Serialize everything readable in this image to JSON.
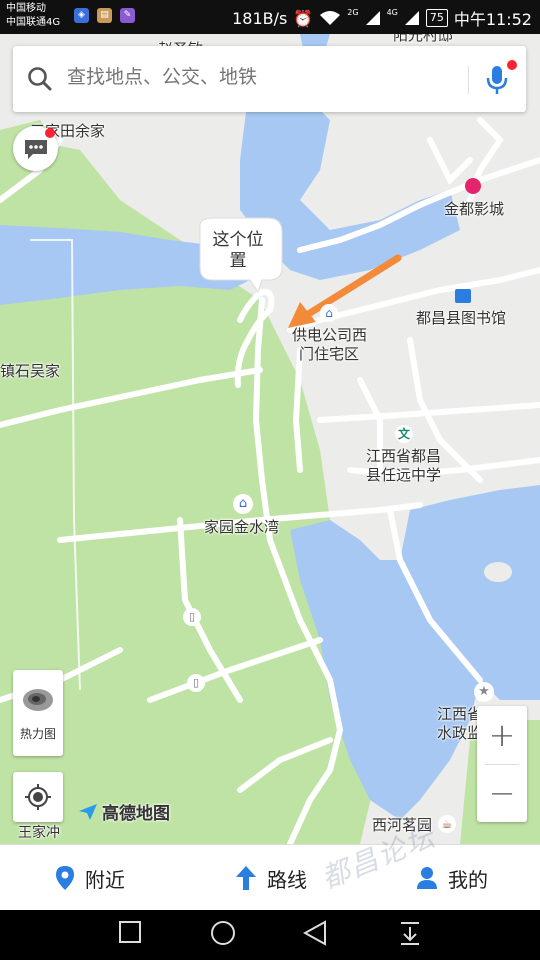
{
  "status_bar": {
    "carrier_1": "中国移动",
    "carrier_2": "中国联通4G",
    "speed": "181B/s",
    "net_label_1": "2G",
    "net_label_2": "4G",
    "battery": "75",
    "time": "中午11:52"
  },
  "search": {
    "placeholder": "查找地点、公交、地铁"
  },
  "map": {
    "labels": {
      "top_partial_1": "赵圣敏",
      "top_partial_2": "阳光村邸",
      "yujia": "五家田余家",
      "wujia": "镇石吴家",
      "cinema": "金都影城",
      "library": "都昌县图书馆",
      "power_line1": "供电公司西",
      "power_line2": "门住宅区",
      "school_line1": "江西省都昌",
      "school_line2": "县任远中学",
      "jinshuiwan": "家园金水湾",
      "water_line1": "江西省都昌县",
      "water_line2": "水政监察",
      "xihe": "西河茗园",
      "wangjia": "王家冲",
      "bubble_line1": "这个位",
      "bubble_line2": "置"
    },
    "colors": {
      "land": "#ececea",
      "green": "#bfe3a4",
      "water": "#a7c8f2",
      "road": "#ffffff",
      "arrow": "#f28a3a"
    }
  },
  "controls": {
    "heatmap_label": "热力图",
    "zoom_in": "+",
    "zoom_out": "−",
    "logo": "高德地图"
  },
  "tabs": [
    {
      "label": "附近",
      "icon": "location-pin-icon"
    },
    {
      "label": "路线",
      "icon": "route-arrow-icon"
    },
    {
      "label": "我的",
      "icon": "user-icon"
    }
  ],
  "watermark": "都昌论坛"
}
